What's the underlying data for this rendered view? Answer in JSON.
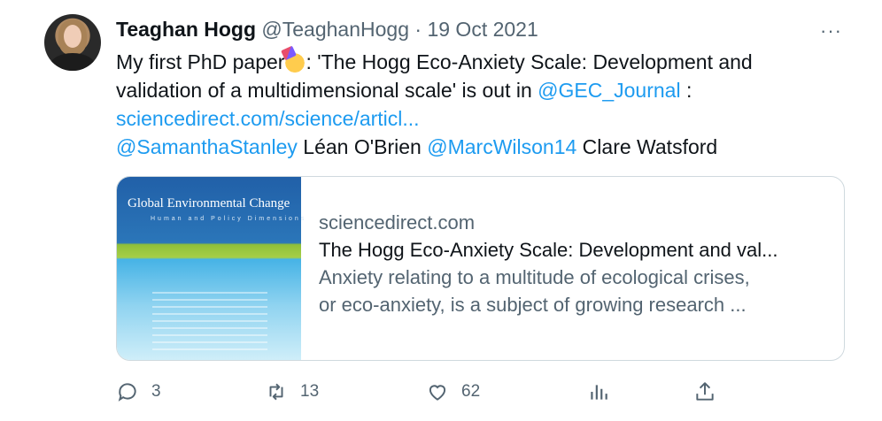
{
  "tweet": {
    "author_name": "Teaghan Hogg",
    "author_handle": "@TeaghanHogg",
    "separator": "·",
    "date": "19 Oct 2021",
    "more": "···",
    "text_part1": "My first PhD paper",
    "text_part2": ": 'The Hogg Eco-Anxiety Scale: Development and",
    "text_line2": "validation of a multidimensional scale' is out in ",
    "mention_journal": "@GEC_Journal",
    "text_line2_end": " :",
    "link": "sciencedirect.com/science/articl...",
    "mention1": "@SamanthaStanley",
    "name2": " Léan O'Brien ",
    "mention2": "@MarcWilson14",
    "name3": " Clare Watsford"
  },
  "card": {
    "cover_title": "Global Environmental Change",
    "cover_subtitle": "Human and Policy Dimensions",
    "domain": "sciencedirect.com",
    "title": "The Hogg Eco-Anxiety Scale: Development and val...",
    "desc_line1": "Anxiety relating to a multitude of ecological crises,",
    "desc_line2": "or eco-anxiety, is a subject of growing research ..."
  },
  "actions": {
    "replies": "3",
    "retweets": "13",
    "likes": "62"
  },
  "colors": {
    "link": "#1d9bf0",
    "muted": "#536471",
    "text": "#0f1419"
  }
}
